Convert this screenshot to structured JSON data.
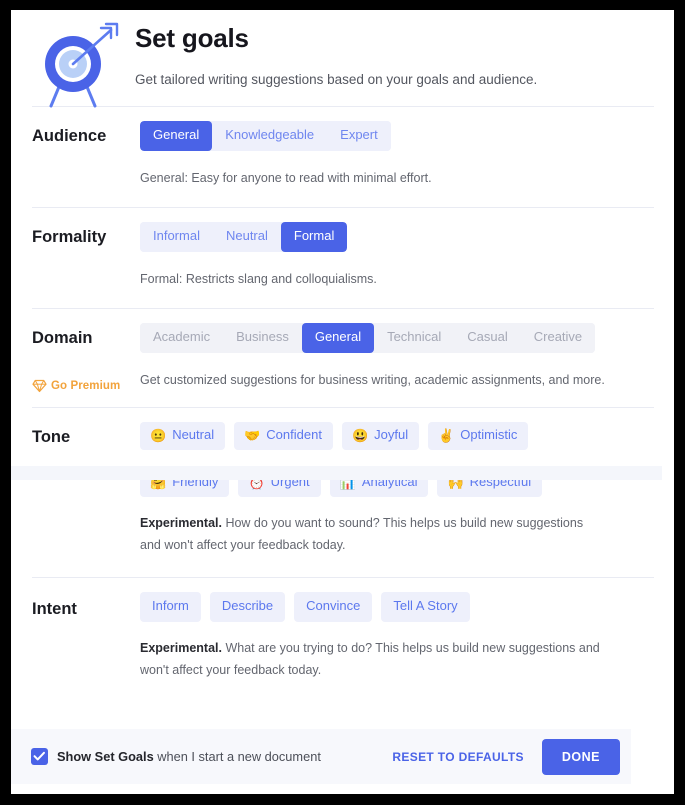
{
  "header": {
    "title": "Set goals",
    "subtitle": "Get tailored writing suggestions based on your goals and audience.",
    "icon": "target-with-arrow-icon"
  },
  "colors": {
    "accent_blue": "#4A63E7",
    "chip_bg": "#EEF0FB",
    "chip_text": "#5C78EE",
    "dim_text": "#A6A9B6",
    "premium_orange": "#F2A33C",
    "footer_bg": "#F7F8FC",
    "divider": "#E9EBF3"
  },
  "sections": {
    "audience": {
      "label": "Audience",
      "options": [
        "General",
        "Knowledgeable",
        "Expert"
      ],
      "selected": "General",
      "help": "General: Easy for anyone to read with minimal effort."
    },
    "formality": {
      "label": "Formality",
      "options": [
        "Informal",
        "Neutral",
        "Formal"
      ],
      "selected": "Formal",
      "help": "Formal: Restricts slang and colloquialisms."
    },
    "domain": {
      "label": "Domain",
      "options": [
        "Academic",
        "Business",
        "General",
        "Technical",
        "Casual",
        "Creative"
      ],
      "selected": "General",
      "locked": [
        "Academic",
        "Business",
        "Technical",
        "Casual",
        "Creative"
      ],
      "premium_label": "Go Premium",
      "premium_icon": "diamond-gem-icon",
      "help": "Get customized suggestions for business writing, academic assignments, and more."
    },
    "tone": {
      "label": "Tone",
      "row1": [
        {
          "emoji": "😐",
          "emoji_name": "neutral-face-emoji",
          "label": "Neutral"
        },
        {
          "emoji": "🤝",
          "emoji_name": "handshake-emoji",
          "label": "Confident"
        },
        {
          "emoji": "😃",
          "emoji_name": "grinning-face-emoji",
          "label": "Joyful"
        },
        {
          "emoji": "✌️",
          "emoji_name": "victory-hand-emoji",
          "label": "Optimistic"
        }
      ],
      "row2": [
        {
          "emoji": "🤗",
          "emoji_name": "hugging-face-emoji",
          "label": "Friendly"
        },
        {
          "emoji": "⏰",
          "emoji_name": "alarm-clock-emoji",
          "label": "Urgent"
        },
        {
          "emoji": "📊",
          "emoji_name": "bar-chart-emoji",
          "label": "Analytical"
        },
        {
          "emoji": "🙌",
          "emoji_name": "raising-hands-emoji",
          "label": "Respectful"
        }
      ],
      "help_bold": "Experimental.",
      "help_rest": " How do you want to sound? This helps us build new suggestions and won't affect your feedback today."
    },
    "intent": {
      "label": "Intent",
      "options": [
        "Inform",
        "Describe",
        "Convince",
        "Tell A Story"
      ],
      "help_bold": "Experimental.",
      "help_rest": " What are you trying to do? This helps us build new suggestions and won't affect your feedback today."
    }
  },
  "footer": {
    "checkbox_checked": true,
    "checkbox_label_bold": "Show Set Goals",
    "checkbox_label_rest": " when I start a new document",
    "reset_label": "RESET TO DEFAULTS",
    "done_label": "DONE"
  }
}
